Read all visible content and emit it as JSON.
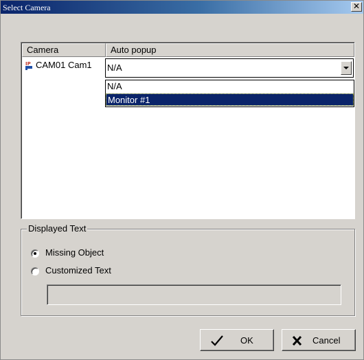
{
  "window": {
    "title": "Select Camera",
    "close_glyph": "✕"
  },
  "list": {
    "columns": [
      "Camera",
      "Auto popup"
    ],
    "rows": [
      {
        "icon": "ip-camera-icon",
        "camera": "CAM01 Cam1",
        "auto_popup": "N/A"
      }
    ]
  },
  "dropdown": {
    "selected": "N/A",
    "options": [
      "N/A",
      "Monitor #1"
    ],
    "highlighted": "Monitor #1"
  },
  "displayed_text": {
    "legend": "Displayed Text",
    "options": [
      "Missing Object",
      "Customized Text"
    ],
    "selected": "Missing Object",
    "custom_text_value": ""
  },
  "buttons": {
    "ok": "OK",
    "cancel": "Cancel"
  },
  "colors": {
    "selection": "#0a246a",
    "face": "#d6d3ce"
  }
}
